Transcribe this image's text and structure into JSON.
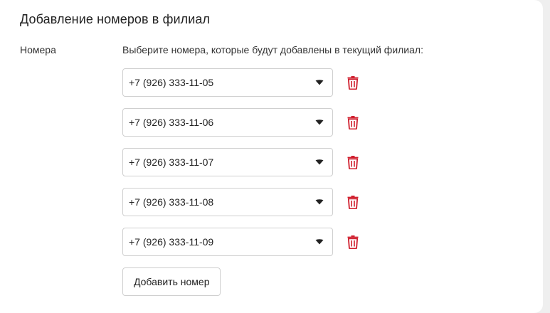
{
  "page": {
    "title": "Добавление номеров в филиал",
    "field_label": "Номера",
    "hint": "Выберите номера, которые будут добавлены в текущий филиал:",
    "add_button_label": "Добавить номер"
  },
  "numbers": [
    {
      "value": "+7 (926) 333-11-05"
    },
    {
      "value": "+7 (926) 333-11-06"
    },
    {
      "value": "+7 (926) 333-11-07"
    },
    {
      "value": "+7 (926) 333-11-08"
    },
    {
      "value": "+7 (926) 333-11-09"
    }
  ],
  "icons": {
    "dropdown": "chevron-down-icon",
    "delete": "trash-icon"
  },
  "colors": {
    "delete_icon": "#d01f2e",
    "caret": "#222222",
    "border": "#cfcfcf"
  }
}
